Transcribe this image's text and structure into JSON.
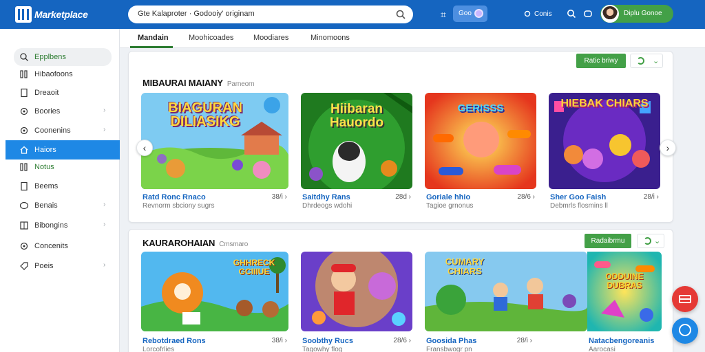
{
  "app": {
    "logo_text": "Marketplace"
  },
  "search": {
    "value": "Gte Kalaproter · Godooiy' originam"
  },
  "header": {
    "mode_label": "Goo",
    "link_label": "Conis",
    "user_name": "Diplu Gonoe"
  },
  "subnav": {
    "tabs": [
      {
        "label": "Mandain"
      },
      {
        "label": "Moohicoades"
      },
      {
        "label": "Moodiares"
      },
      {
        "label": "Minomoons"
      }
    ]
  },
  "sidebar": {
    "items": [
      {
        "label": "Epplbens",
        "icon": "search-icon"
      },
      {
        "label": "Hibaofoons",
        "icon": "columns-icon"
      },
      {
        "label": "Dreaoit",
        "icon": "document-icon"
      },
      {
        "label": "Boories",
        "icon": "gear-icon"
      },
      {
        "label": "Coonenins",
        "icon": "gear-icon"
      },
      {
        "label": "Haiors",
        "icon": "home-icon"
      },
      {
        "label": "Notus",
        "icon": "columns-icon"
      },
      {
        "label": "Beems",
        "icon": "document-icon"
      },
      {
        "label": "Benais",
        "icon": "chat-icon"
      },
      {
        "label": "Bibongins",
        "icon": "grid-icon"
      },
      {
        "label": "Concenits",
        "icon": "gear-icon"
      },
      {
        "label": "Poeis",
        "icon": "tag-icon"
      }
    ]
  },
  "panels": [
    {
      "title": "MIBAURAI MAIANY",
      "subtitle": "Parneorn",
      "button_label": "Ratic briwy",
      "cards": [
        {
          "image_text": "BIAGURAN DILIASIKG",
          "title": "Ratd Ronc Rnaco",
          "meta": "38/i ›",
          "sub": "Revnorm sbciony sugrs"
        },
        {
          "image_text": "Hiibaran Hauordo",
          "title": "Saitdhy Rans",
          "meta": "28d ›",
          "sub": "Dhrdeogs wdohi"
        },
        {
          "image_text": "GERISSS",
          "title": "Goriale hhio",
          "meta": "28/6 ›",
          "sub": "Tagioe grnonus"
        },
        {
          "image_text": "HIEBAK CHIARS",
          "title": "Sher Goo Faish",
          "meta": "28/i ›",
          "sub": "Debmrls flosmins ll"
        }
      ]
    },
    {
      "title": "KAURAROHAIAN",
      "subtitle": "Cmsmaro",
      "button_label": "Radaibrmu",
      "cards": [
        {
          "image_text": "GHHRECK GCIIIUE",
          "title": "Rebotdraed Rons",
          "meta": "38/i ›",
          "sub": "Lorcofrlies"
        },
        {
          "image_text": "",
          "title": "Soobthy Rucs",
          "meta": "28/6 ›",
          "sub": "Tagowhy flog"
        },
        {
          "image_text": "CUMARY CHIARS",
          "title": "Goosida Phas",
          "meta": "28/i ›",
          "sub": "Fransbwogr pn"
        },
        {
          "image_text": "ODDUINE DUBRAS",
          "title": "Natacbengoreanis",
          "meta": "28/i ›",
          "sub": "Aarocasi"
        }
      ]
    }
  ]
}
